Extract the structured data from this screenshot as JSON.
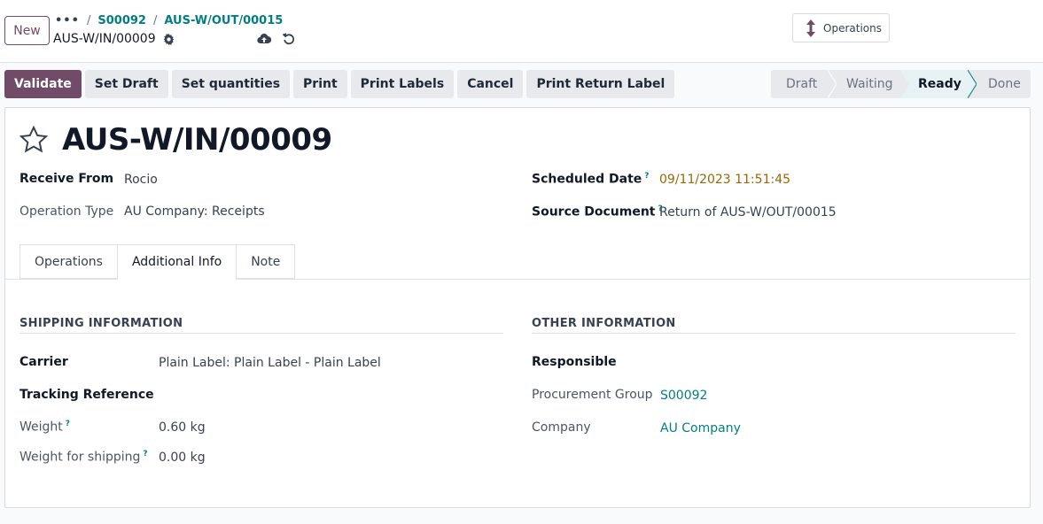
{
  "header": {
    "new_label": "New",
    "breadcrumb_more": "•••",
    "breadcrumb": [
      "S00092",
      "AUS-W/OUT/00015"
    ],
    "record_name": "AUS-W/IN/00009",
    "operations_button": "Operations"
  },
  "actions": [
    "Validate",
    "Set Draft",
    "Set quantities",
    "Print",
    "Print Labels",
    "Cancel",
    "Print Return Label"
  ],
  "status_steps": [
    "Draft",
    "Waiting",
    "Ready",
    "Done"
  ],
  "status_current": "Ready",
  "form": {
    "title": "AUS-W/IN/00009",
    "receive_from_label": "Receive From",
    "receive_from": "Rocio",
    "operation_type_label": "Operation Type",
    "operation_type": "AU Company: Receipts",
    "scheduled_date_label": "Scheduled Date",
    "scheduled_date": "09/11/2023 11:51:45",
    "source_document_label": "Source Document",
    "source_document": "Return of AUS-W/OUT/00015",
    "help_mark": "?"
  },
  "tabs": [
    "Operations",
    "Additional Info",
    "Note"
  ],
  "active_tab": "Additional Info",
  "shipping": {
    "heading": "SHIPPING INFORMATION",
    "carrier_label": "Carrier",
    "carrier": "Plain Label: Plain Label - Plain Label",
    "tracking_label": "Tracking Reference",
    "weight_label": "Weight",
    "weight": "0.60",
    "weight_unit": "kg",
    "shipping_weight_label": "Weight for shipping",
    "shipping_weight": "0.00",
    "shipping_weight_unit": "kg"
  },
  "other": {
    "heading": "OTHER INFORMATION",
    "responsible_label": "Responsible",
    "procurement_label": "Procurement Group",
    "procurement": "S00092",
    "company_label": "Company",
    "company": "AU Company"
  },
  "colors": {
    "primary": "#714b67",
    "link": "#017e84",
    "date": "#9a6700"
  }
}
